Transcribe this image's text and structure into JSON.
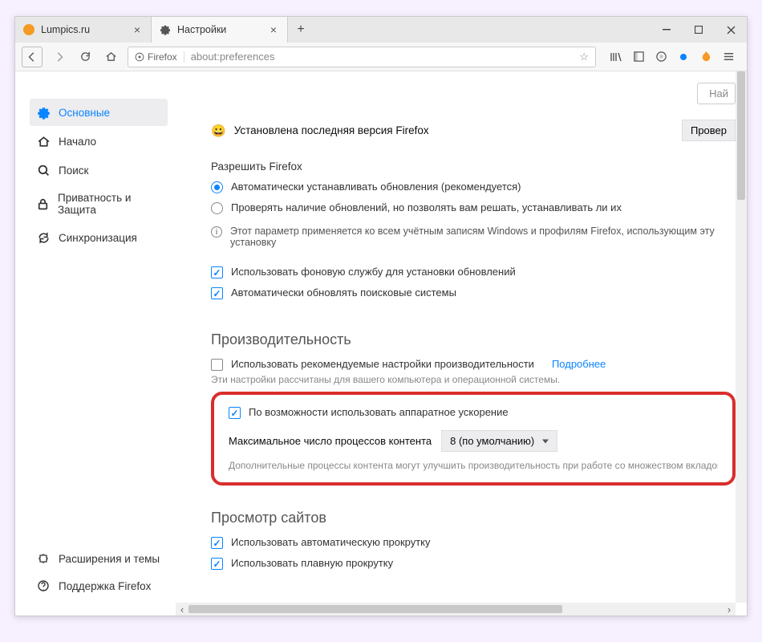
{
  "tabs": [
    {
      "label": "Lumpics.ru"
    },
    {
      "label": "Настройки"
    }
  ],
  "url": {
    "identity": "Firefox",
    "address": "about:preferences"
  },
  "search": {
    "placeholder": "Най"
  },
  "sidebar": {
    "items": [
      {
        "label": "Основные"
      },
      {
        "label": "Начало"
      },
      {
        "label": "Поиск"
      },
      {
        "label": "Приватность и Защита"
      },
      {
        "label": "Синхронизация"
      }
    ],
    "bottom": [
      {
        "label": "Расширения и темы"
      },
      {
        "label": "Поддержка Firefox"
      }
    ]
  },
  "status": {
    "text": "Установлена последняя версия Firefox",
    "check_button": "Провер"
  },
  "updates": {
    "allow_label": "Разрешить Firefox",
    "radio_auto": "Автоматически устанавливать обновления (рекомендуется)",
    "radio_check": "Проверять наличие обновлений, но позволять вам решать, устанавливать ли их",
    "note": "Этот параметр применяется ко всем учётным записям Windows и профилям Firefox, использующим эту установку",
    "bg_service": "Использовать фоновую службу для установки обновлений",
    "auto_search": "Автоматически обновлять поисковые системы"
  },
  "performance": {
    "title": "Производительность",
    "use_recommended": "Использовать рекомендуемые настройки производительности",
    "learn_more": "Подробнее",
    "hint": "Эти настройки рассчитаны для вашего компьютера и операционной системы.",
    "hw_accel": "По возможности использовать аппаратное ускорение",
    "max_processes_label": "Максимальное число процессов контента",
    "max_processes_value": "8 (по умолчанию)",
    "desc": "Дополнительные процессы контента могут улучшить производительность при работе со множеством вкладок, но также повы памяти."
  },
  "browsing": {
    "title": "Просмотр сайтов",
    "auto_scroll": "Использовать автоматическую прокрутку",
    "smooth_scroll": "Использовать плавную прокрутку"
  }
}
